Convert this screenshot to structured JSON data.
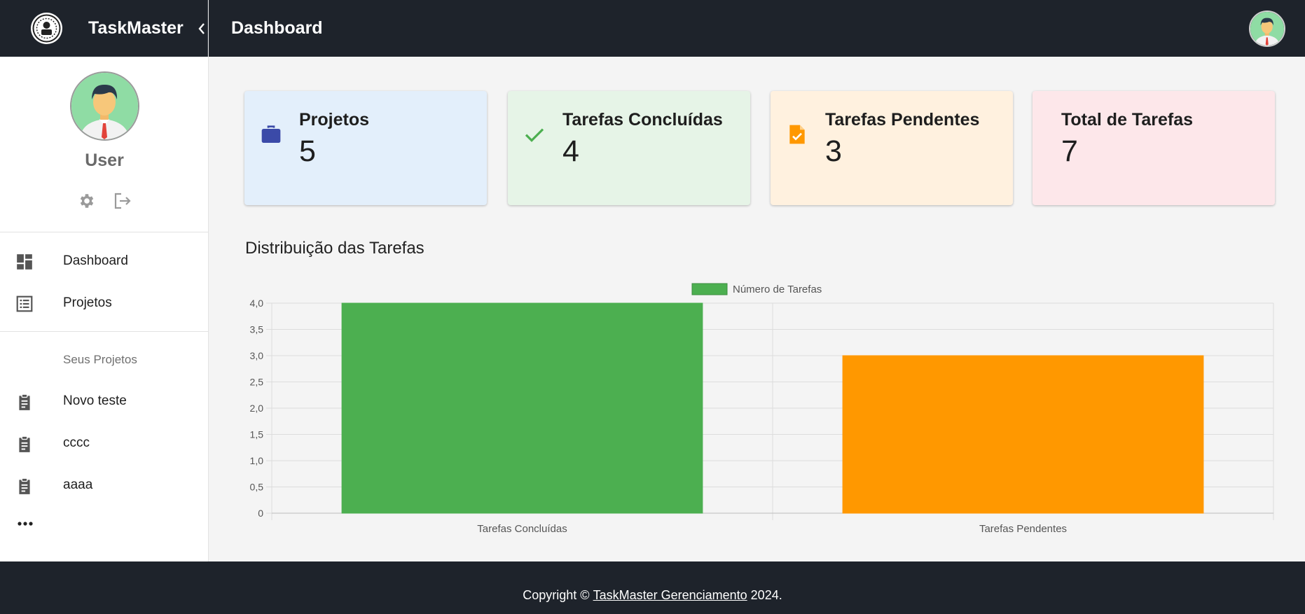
{
  "app": {
    "name": "TaskMaster",
    "accent": "#1e232b"
  },
  "header": {
    "title": "Dashboard"
  },
  "user": {
    "name": "User"
  },
  "sidebar": {
    "nav": [
      {
        "label": "Dashboard",
        "icon": "dashboard-icon"
      },
      {
        "label": "Projetos",
        "icon": "list-icon"
      }
    ],
    "section_label": "Seus Projetos",
    "projects": [
      {
        "label": "Novo teste",
        "icon": "clipboard-icon"
      },
      {
        "label": "cccc",
        "icon": "clipboard-icon"
      },
      {
        "label": "aaaa",
        "icon": "clipboard-icon"
      }
    ]
  },
  "cards": [
    {
      "title": "Projetos",
      "value": "5",
      "icon": "briefcase-icon",
      "bg": "#e3effb",
      "color": "#3b4aa8"
    },
    {
      "title": "Tarefas Concluídas",
      "value": "4",
      "icon": "check-icon",
      "bg": "#e6f4e7",
      "color": "#4caf50"
    },
    {
      "title": "Tarefas Pendentes",
      "value": "3",
      "icon": "pending-file-icon",
      "bg": "#fff1df",
      "color": "#ff9800"
    },
    {
      "title": "Total de Tarefas",
      "value": "7",
      "icon": "",
      "bg": "#fde7ea",
      "color": "#222222"
    }
  ],
  "chart_section": {
    "title": "Distribuição das Tarefas"
  },
  "chart_data": {
    "type": "bar",
    "categories": [
      "Tarefas Concluídas",
      "Tarefas Pendentes"
    ],
    "series": [
      {
        "name": "Número de Tarefas",
        "values": [
          4,
          3
        ]
      }
    ],
    "bar_colors": [
      "#4caf50",
      "#ff9800"
    ],
    "ylim": [
      0,
      4
    ],
    "yticks": [
      "0",
      "0,5",
      "1,0",
      "1,5",
      "2,0",
      "2,5",
      "3,0",
      "3,5",
      "4,0"
    ],
    "grid": true,
    "legend": "top-center"
  },
  "footer": {
    "prefix": "Copyright ©",
    "link": "TaskMaster Gerenciamento",
    "suffix": "2024."
  }
}
